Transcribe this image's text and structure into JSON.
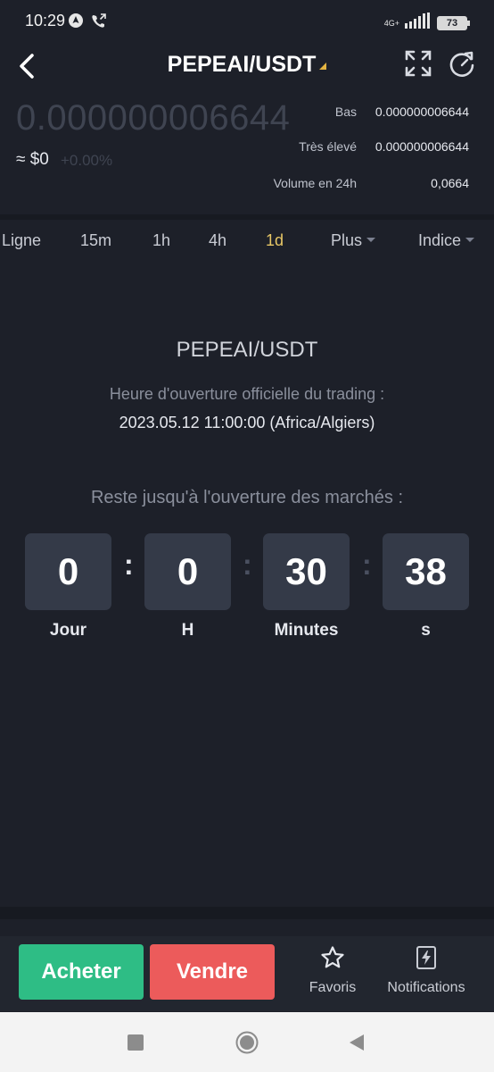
{
  "status_bar": {
    "time": "10:29",
    "network": "4G+",
    "battery": "73"
  },
  "header": {
    "pair": "PEPEAI/USDT"
  },
  "price": {
    "last": "0.000000006644",
    "usd": "≈ $0",
    "change": "+0.00%"
  },
  "stats": [
    {
      "label": "Bas",
      "value": "0.000000006644"
    },
    {
      "label": "Très élevé",
      "value": "0.000000006644"
    },
    {
      "label": "Volume en 24h",
      "value": "0,0664"
    }
  ],
  "tabs": [
    "Ligne",
    "15m",
    "1h",
    "4h",
    "1d",
    "Plus",
    "Indice"
  ],
  "active_tab": "1d",
  "launch": {
    "pair": "PEPEAI/USDT",
    "open_label": "Heure d'ouverture officielle du trading :",
    "open_time": "2023.05.12 11:00:00 (Africa/Algiers)",
    "remaining_label": "Reste jusqu'à l'ouverture des marchés :"
  },
  "countdown": [
    {
      "value": "0",
      "label": "Jour"
    },
    {
      "value": "0",
      "label": "H"
    },
    {
      "value": "30",
      "label": "Minutes"
    },
    {
      "value": "38",
      "label": "s"
    }
  ],
  "actions": {
    "buy": "Acheter",
    "sell": "Vendre",
    "favorites": "Favoris",
    "notifications": "Notifications"
  },
  "colors": {
    "background": "#1d2029",
    "buy": "#2ebd85",
    "sell": "#ec5b5b",
    "active_tab": "#e7c766"
  },
  "icons": {
    "back": "chevron-left-icon",
    "fullscreen": "fullscreen-icon",
    "refresh": "refresh-icon",
    "favorites": "star-icon",
    "notifications": "lightning-icon"
  }
}
